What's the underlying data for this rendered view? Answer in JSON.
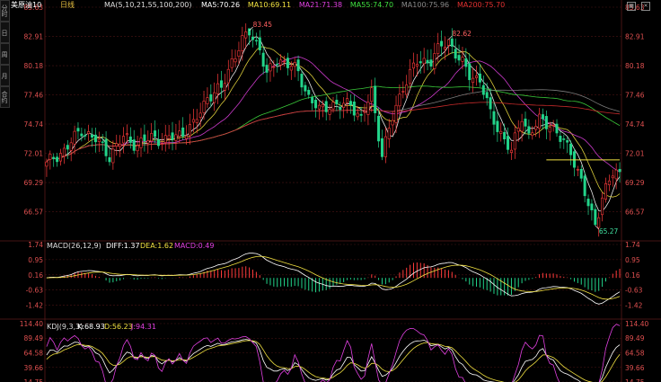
{
  "header": {
    "title": "美原油10",
    "period": "日线",
    "ma_prefix": "MA(5,10,21,55,100,200)",
    "ma_values": [
      {
        "label": "MA5:",
        "value": "70.26",
        "color": "#ffffff"
      },
      {
        "label": "MA10:",
        "value": "69.11",
        "color": "#f0e040"
      },
      {
        "label": "MA21:",
        "value": "71.38",
        "color": "#e040e0"
      },
      {
        "label": "MA55:",
        "value": "74.70",
        "color": "#40e040"
      },
      {
        "label": "MA100:",
        "value": "75.96",
        "color": "#888888"
      },
      {
        "label": "MA200:",
        "value": "75.70",
        "color": "#e03030"
      }
    ]
  },
  "side_toolbar": {
    "tabs": [
      "分时",
      "日",
      "周",
      "月",
      "合约"
    ]
  },
  "icons": [
    "grid-icon",
    "close-icon"
  ],
  "colors": {
    "up": "#ff3b3b",
    "down": "#22d48a",
    "grid": "#4a1515",
    "axis_text": "#e05050"
  },
  "chart_data": [
    {
      "type": "candlestick",
      "y_ticks": [
        "85.63",
        "82.91",
        "80.18",
        "77.46",
        "74.74",
        "72.01",
        "69.29",
        "66.57"
      ],
      "ylim": [
        63.85,
        85.63
      ],
      "annotations": [
        {
          "text": "83.45",
          "index": 58,
          "value": 83.45
        },
        {
          "text": "82.62",
          "index": 115,
          "value": 82.62
        },
        {
          "text": "65.27",
          "index": 157,
          "value": 65.27
        }
      ],
      "horizontal_line": {
        "value": 71.4,
        "from_index": 143
      },
      "anchors": [
        [
          0,
          71.0
        ],
        [
          5,
          72.3
        ],
        [
          10,
          74.2
        ],
        [
          14,
          73.3
        ],
        [
          18,
          71.8
        ],
        [
          22,
          73.5
        ],
        [
          26,
          72.8
        ],
        [
          30,
          73.5
        ],
        [
          34,
          73.2
        ],
        [
          38,
          73.8
        ],
        [
          42,
          74.6
        ],
        [
          46,
          77.3
        ],
        [
          50,
          78.0
        ],
        [
          53,
          80.7
        ],
        [
          56,
          82.4
        ],
        [
          58,
          83.4
        ],
        [
          61,
          81.8
        ],
        [
          63,
          79.2
        ],
        [
          66,
          80.8
        ],
        [
          69,
          80.3
        ],
        [
          72,
          79.6
        ],
        [
          75,
          77.2
        ],
        [
          78,
          76.0
        ],
        [
          81,
          76.6
        ],
        [
          84,
          76.3
        ],
        [
          87,
          76.8
        ],
        [
          90,
          75.1
        ],
        [
          93,
          77.7
        ],
        [
          96,
          71.9
        ],
        [
          99,
          75.3
        ],
        [
          102,
          78.3
        ],
        [
          106,
          80.5
        ],
        [
          110,
          80.7
        ],
        [
          113,
          82.0
        ],
        [
          115,
          82.5
        ],
        [
          118,
          80.8
        ],
        [
          121,
          79.3
        ],
        [
          124,
          78.9
        ],
        [
          127,
          75.6
        ],
        [
          130,
          73.9
        ],
        [
          133,
          72.1
        ],
        [
          136,
          75.6
        ],
        [
          138,
          73.6
        ],
        [
          141,
          75.1
        ],
        [
          144,
          74.8
        ],
        [
          147,
          73.3
        ],
        [
          150,
          72.3
        ],
        [
          153,
          69.3
        ],
        [
          155,
          67.1
        ],
        [
          157,
          65.5
        ],
        [
          159,
          67.9
        ],
        [
          162,
          70.1
        ],
        [
          164,
          70.3
        ]
      ]
    },
    {
      "type": "macd",
      "title": "MACD(26,12,9)",
      "values": [
        {
          "label": "DIFF:",
          "value": "1.37",
          "color": "#ffffff"
        },
        {
          "label": "DEA:",
          "value": "1.62",
          "color": "#f0e040"
        },
        {
          "label": "MACD:",
          "value": "0.49",
          "color": "#e040e0"
        }
      ],
      "y_ticks": [
        "1.74",
        "0.95",
        "0.16",
        "-0.63",
        "-1.42"
      ],
      "ylim": [
        -2.05,
        1.74
      ]
    },
    {
      "type": "kdj",
      "title": "KDJ(9,3,3)",
      "values": [
        {
          "label": "K:",
          "value": "68.93",
          "color": "#ffffff"
        },
        {
          "label": "D:",
          "value": "56.23",
          "color": "#f0e040"
        },
        {
          "label": "J:",
          "value": "94.31",
          "color": "#e040e0"
        }
      ],
      "y_ticks": [
        "114.40",
        "89.49",
        "64.58",
        "39.66",
        "14.75"
      ],
      "ylim": [
        14.75,
        114.4
      ]
    }
  ]
}
